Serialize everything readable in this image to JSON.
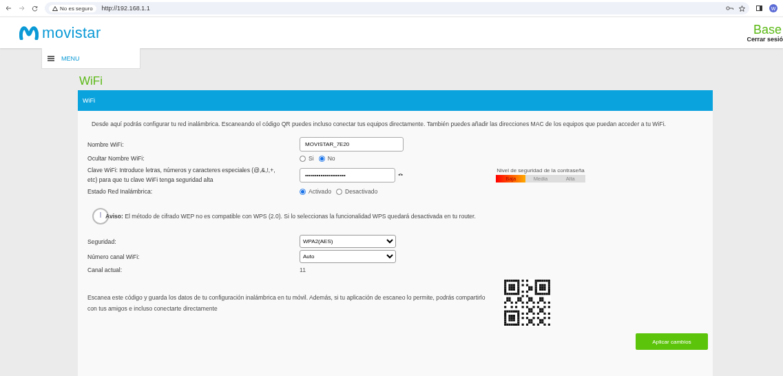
{
  "browser": {
    "security_label": "No es seguro",
    "url": "http://192.168.1.1",
    "profile_initial": "W"
  },
  "header": {
    "brand": "movistar",
    "product": "Base",
    "logout": "Cerrar sesió"
  },
  "menu": {
    "label": "MENU"
  },
  "page_title": "WiFi",
  "panel": {
    "title": "WiFi",
    "intro": "Desde aquí podrás configurar tu red inalámbrica. Escaneando el código QR puedes incluso conectar tus equipos directamente. También puedes añadir las direcciones MAC de los equipos que puedan acceder a tu WiFi.",
    "fields": [
      {
        "kind": "text",
        "label": "Nombre WiFi:",
        "value": "MOVISTAR_7E20"
      },
      {
        "kind": "radio",
        "label": "Ocultar Nombre WiFi:",
        "options": [
          {
            "label": "Si",
            "selected": false
          },
          {
            "label": "No",
            "selected": true
          }
        ]
      },
      {
        "kind": "password",
        "label": "Clave WiFi: Introduce letras, números y caracteres especiales (@,&,!,+, etc) para que tu clave WiFi tenga seguridad alta",
        "value": "•••••••••••••••••••••",
        "strength": {
          "title": "Nivel de seguridad de la contraseña",
          "level": 0.33,
          "steps": [
            "Baja",
            "Media",
            "Alta"
          ]
        }
      },
      {
        "kind": "radio",
        "label": "Estado Red Inalámbrica:",
        "options": [
          {
            "label": "Activado",
            "selected": true
          },
          {
            "label": "Desactivado",
            "selected": false
          }
        ]
      }
    ],
    "notice": "**Aviso:** El método de cifrado WEP no es compatible con WPS (2.0). Si lo seleccionas la funcionalidad WPS quedará desactivada en tu router.",
    "settings": [
      {
        "kind": "select",
        "label": "Seguridad:",
        "value": "WPA2(AES)"
      },
      {
        "kind": "select",
        "label": "Número canal WiFi:",
        "value": "Auto"
      },
      {
        "kind": "static",
        "label": "Canal actual:",
        "value": "11"
      }
    ],
    "qr_text": "Escanea este código y guarda los datos de tu configuración inalámbrica en tu móvil. Además, si tu aplicación de escaneo lo permite, podrás compartirlo con tus amigos e incluso conectarte directamente",
    "apply_button": "Aplicar cambios"
  }
}
